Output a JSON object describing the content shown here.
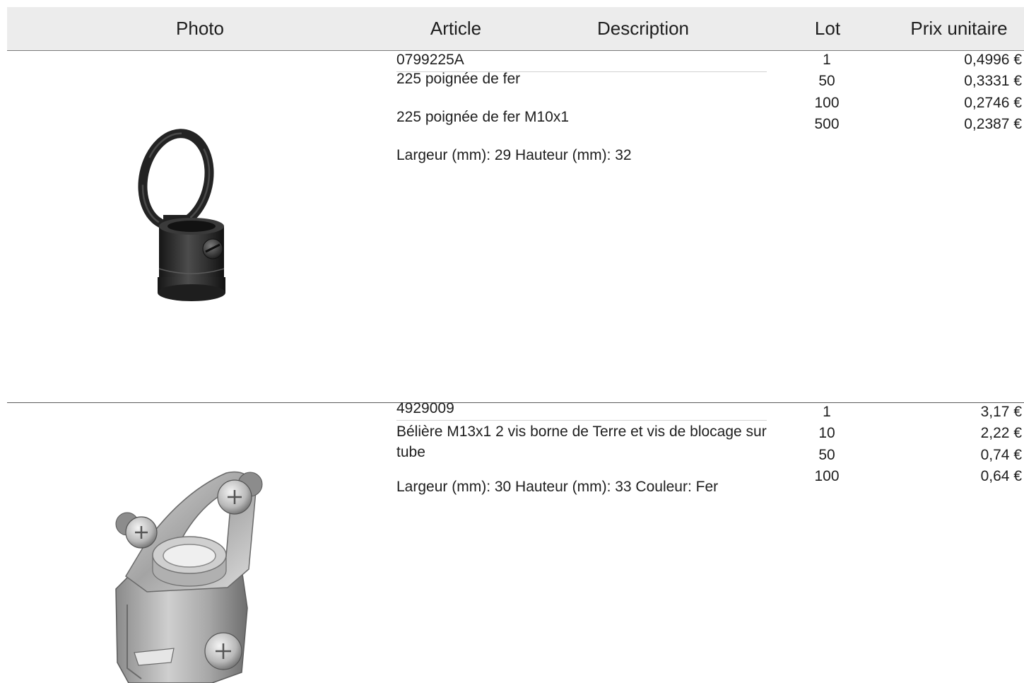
{
  "colors": {
    "header_background": "#ececec",
    "text": "#1e1e1e",
    "rule": "#7a7a7a",
    "row_divider": "#5a5a5a"
  },
  "table": {
    "headers": {
      "photo": "Photo",
      "article": "Article",
      "description": "Description",
      "lot": "Lot",
      "unit_price": "Prix unitaire"
    }
  },
  "products": [
    {
      "photo_icon": "iron-ring-handle-photo",
      "article": "0799225A",
      "name": "225 poignée de fer",
      "description": "225 poignée de fer M10x1",
      "dimensions": "Largeur (mm): 29 Hauteur (mm): 32",
      "price_tiers": [
        {
          "lot": "1",
          "price": "0,4996 €"
        },
        {
          "lot": "50",
          "price": "0,3331 €"
        },
        {
          "lot": "100",
          "price": "0,2746 €"
        },
        {
          "lot": "500",
          "price": "0,2387 €"
        }
      ]
    },
    {
      "photo_icon": "tube-bracket-with-screws-photo",
      "article": "4929009",
      "name": "Bélière M13x1 2 vis borne de Terre et vis de blocage sur tube",
      "dimensions": "Largeur (mm): 30 Hauteur (mm): 33 Couleur: Fer",
      "price_tiers": [
        {
          "lot": "1",
          "price": "3,17 €"
        },
        {
          "lot": "10",
          "price": "2,22 €"
        },
        {
          "lot": "50",
          "price": "0,74 €"
        },
        {
          "lot": "100",
          "price": "0,64 €"
        }
      ]
    }
  ]
}
